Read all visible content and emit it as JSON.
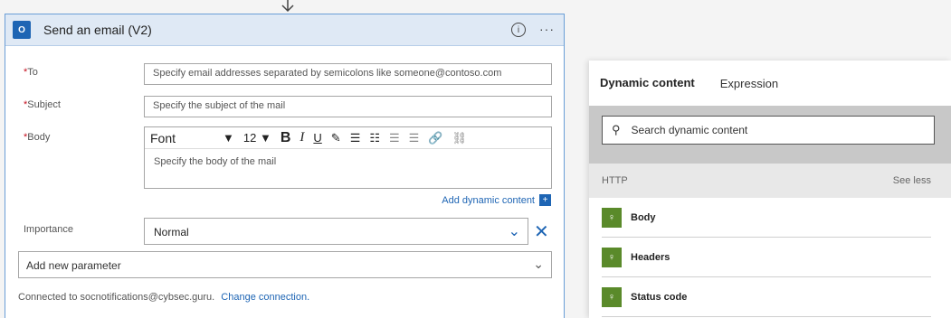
{
  "card": {
    "title": "Send an email (V2)",
    "info_glyph": "i",
    "more_glyph": "···"
  },
  "fields": {
    "to": {
      "required_mark": "*",
      "label": "To",
      "placeholder": "Specify email addresses separated by semicolons like someone@contoso.com"
    },
    "subject": {
      "required_mark": "*",
      "label": "Subject",
      "placeholder": "Specify the subject of the mail"
    },
    "body": {
      "required_mark": "*",
      "label": "Body",
      "placeholder": "Specify the body of the mail"
    }
  },
  "rte_toolbar": {
    "font": "Font",
    "font_size": "12",
    "bold": "B",
    "italic": "I",
    "underline": "U"
  },
  "add_dynamic_content": "Add dynamic content",
  "importance": {
    "label": "Importance",
    "value": "Normal"
  },
  "add_parameter": "Add new parameter",
  "connection": {
    "text": "Connected to socnotifications@cybsec.guru.",
    "link": "Change connection."
  },
  "dynamic_panel": {
    "tabs": [
      "Dynamic content",
      "Expression"
    ],
    "search_placeholder": "Search dynamic content",
    "group": {
      "name": "HTTP",
      "toggle": "See less"
    },
    "items": [
      "Body",
      "Headers",
      "Status code"
    ]
  },
  "colors": {
    "accent": "#1e65b4",
    "header_bg": "#dfe9f5",
    "dyn_icon": "#5a8a2a"
  }
}
